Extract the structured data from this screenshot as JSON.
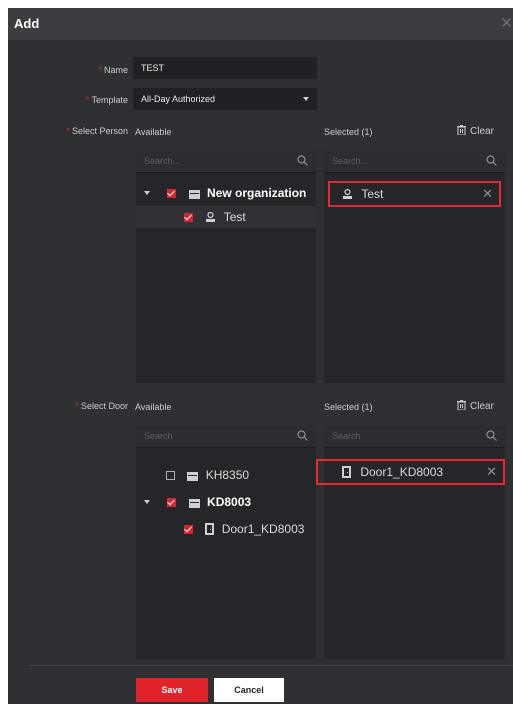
{
  "dialog": {
    "title": "Add",
    "close_icon": "close-icon"
  },
  "form": {
    "name_label": "Name",
    "name_value": "TEST",
    "template_label": "Template",
    "template_value": "All-Day Authorized",
    "select_person_label": "Select Person",
    "select_door_label": "Select Door",
    "required_mark": "*"
  },
  "person": {
    "available_label": "Available",
    "selected_label": "Selected  (1)",
    "clear_label": "Clear",
    "search_placeholder": "Search...",
    "selected_search_placeholder": "Search...",
    "tree": [
      {
        "label": "New organization",
        "checked": true,
        "bold": true,
        "icon": "folder-icon"
      },
      {
        "label": "Test",
        "checked": true,
        "bold": false,
        "icon": "person-icon"
      }
    ],
    "selected_items": [
      {
        "label": "Test",
        "icon": "person-icon"
      }
    ]
  },
  "door": {
    "available_label": "Available",
    "selected_label": "Selected  (1)",
    "clear_label": "Clear",
    "search_placeholder": "Search",
    "selected_search_placeholder": "Search",
    "tree": [
      {
        "label": "KH8350",
        "checked": false,
        "bold": false,
        "icon": "device-icon"
      },
      {
        "label": "KD8003",
        "checked": true,
        "bold": true,
        "icon": "device-icon"
      },
      {
        "label": "Door1_KD8003",
        "checked": true,
        "bold": false,
        "icon": "door-icon"
      }
    ],
    "selected_items": [
      {
        "label": "Door1_KD8003",
        "icon": "door-icon"
      }
    ]
  },
  "footer": {
    "save_label": "Save",
    "cancel_label": "Cancel"
  },
  "colors": {
    "accent": "#e0222b",
    "dialog_bg": "#2e3033",
    "panel_bg": "#242629"
  }
}
